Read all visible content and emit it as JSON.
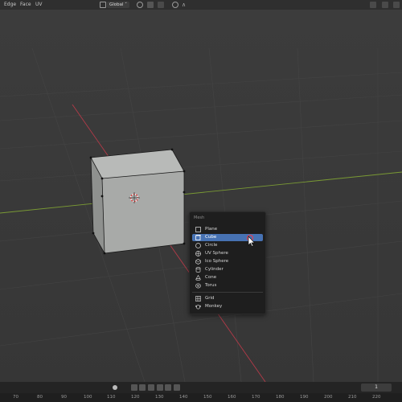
{
  "header": {
    "menus": [
      "Edge",
      "Face",
      "UV"
    ],
    "transform_orientation": "Global",
    "icons": [
      "orientation-icon",
      "pivot-icon",
      "snap-icon",
      "proportional-icon",
      "falloff-icon",
      "gizmo-icon",
      "overlay-icon",
      "xray-icon"
    ]
  },
  "add_menu": {
    "title": "Mesh",
    "items": [
      {
        "label": "Plane",
        "icon": "plane-icon"
      },
      {
        "label": "Cube",
        "icon": "cube-icon",
        "active": true
      },
      {
        "label": "Circle",
        "icon": "circle-icon"
      },
      {
        "label": "UV Sphere",
        "icon": "uv-sphere-icon"
      },
      {
        "label": "Ico Sphere",
        "icon": "ico-sphere-icon"
      },
      {
        "label": "Cylinder",
        "icon": "cylinder-icon"
      },
      {
        "label": "Cone",
        "icon": "cone-icon"
      },
      {
        "label": "Torus",
        "icon": "torus-icon"
      },
      {
        "label": "Grid",
        "icon": "grid-icon"
      },
      {
        "label": "Monkey",
        "icon": "monkey-icon"
      }
    ]
  },
  "timeline": {
    "current_frame": "1",
    "ruler": [
      "70",
      "80",
      "90",
      "100",
      "110",
      "120",
      "130",
      "140",
      "150",
      "160",
      "170",
      "180",
      "190",
      "200",
      "210",
      "220"
    ]
  },
  "colors": {
    "background": "#393939",
    "menu_background": "#1e1e1e",
    "highlight": "#4772b3",
    "x_axis": "#b33a48",
    "y_axis": "#7a9a34",
    "cube_face": "#a8aaa8"
  }
}
